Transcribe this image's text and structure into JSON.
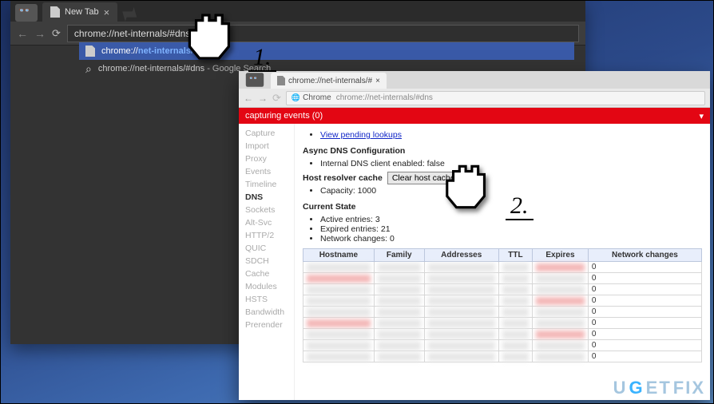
{
  "win1": {
    "tab_title": "New Tab",
    "omnibox_value": "chrome://net-internals/#dns",
    "suggestions": [
      {
        "kind": "page",
        "prefix": "chrome://",
        "match": "net-internals/#dns",
        "suffix": ""
      },
      {
        "kind": "search",
        "prefix": "chrome://net-internals/#dns",
        "match": "",
        "suffix": " - Google Search"
      }
    ]
  },
  "win2": {
    "tab_title": "chrome://net-internals/#",
    "om_chip": "Chrome",
    "om_path": "chrome://net-internals/#dns",
    "redbar": "capturing events (0)",
    "sidebar": [
      "Capture",
      "Import",
      "Proxy",
      "Events",
      "Timeline",
      "DNS",
      "Sockets",
      "Alt-Svc",
      "HTTP/2",
      "QUIC",
      "SDCH",
      "Cache",
      "Modules",
      "HSTS",
      "Bandwidth",
      "Prerender"
    ],
    "sidebar_active": "DNS",
    "view_pending": "View pending lookups",
    "async_h": "Async DNS Configuration",
    "async_item": "Internal DNS client enabled: false",
    "hr_label": "Host resolver cache",
    "hr_button": "Clear host cache",
    "capacity": "Capacity: 1000",
    "current_h": "Current State",
    "cs_items": [
      "Active entries: 3",
      "Expired entries: 21",
      "Network changes: 0"
    ],
    "table": {
      "headers": [
        "Hostname",
        "Family",
        "Addresses",
        "TTL",
        "Expires",
        "Network changes"
      ],
      "nc_values": [
        "0",
        "0",
        "0",
        "0",
        "0",
        "0",
        "0",
        "0",
        "0"
      ]
    }
  },
  "labels": {
    "one": "1.",
    "two": "2."
  },
  "watermark": {
    "u": "U",
    "g": "G",
    "rest1": "ET",
    "rest2": "FIX"
  }
}
